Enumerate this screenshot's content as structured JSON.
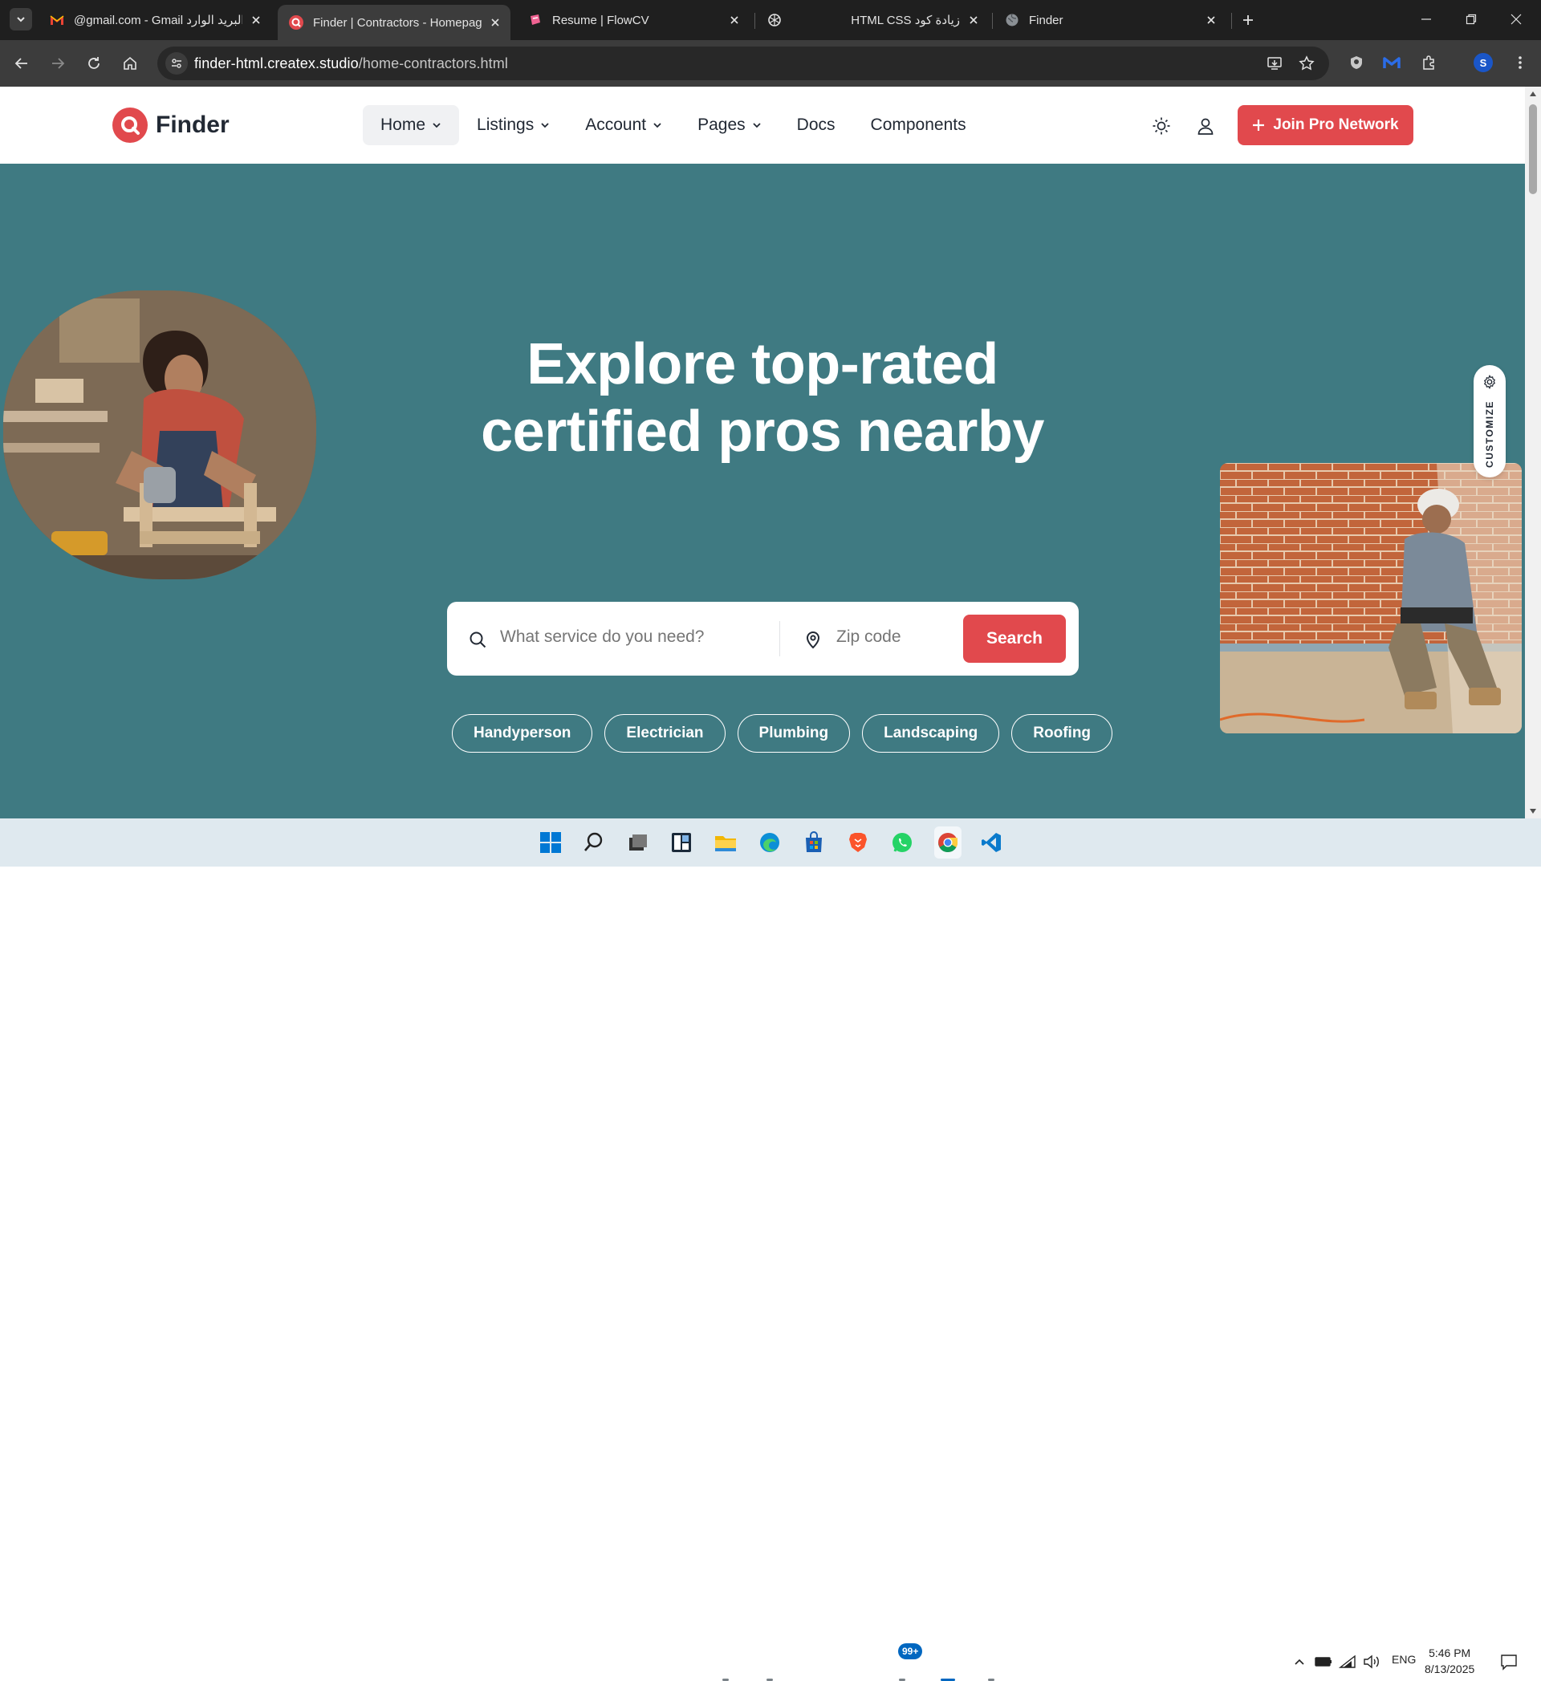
{
  "browser": {
    "tabs": [
      {
        "title": "@gmail.com - Gmail البريد الوارد",
        "favicon": "gmail-icon",
        "active": false
      },
      {
        "title": "Finder | Contractors - Homepage",
        "favicon": "finder-icon",
        "active": true
      },
      {
        "title": "Resume | FlowCV",
        "favicon": "flowcv-icon",
        "active": false
      },
      {
        "title": "HTML CSS زيادة كود",
        "favicon": "chatgpt-icon",
        "active": false
      },
      {
        "title": "Finder",
        "favicon": "globe-icon",
        "active": false
      }
    ],
    "url_host": "finder-html.createx.studio",
    "url_path": "/home-contractors.html",
    "profile_initial": "S"
  },
  "site": {
    "logo_text": "Finder",
    "nav": [
      {
        "label": "Home",
        "has_dropdown": true,
        "active": true
      },
      {
        "label": "Listings",
        "has_dropdown": true,
        "active": false
      },
      {
        "label": "Account",
        "has_dropdown": true,
        "active": false
      },
      {
        "label": "Pages",
        "has_dropdown": true,
        "active": false
      },
      {
        "label": "Docs",
        "has_dropdown": false,
        "active": false
      },
      {
        "label": "Components",
        "has_dropdown": false,
        "active": false
      }
    ],
    "join_button": "Join Pro Network",
    "hero": {
      "title_line1": "Explore top-rated",
      "title_line2": "certified pros nearby",
      "search_placeholder": "What service do you need?",
      "zip_placeholder": "Zip code",
      "search_button": "Search",
      "chips": [
        "Handyperson",
        "Electrician",
        "Plumbing",
        "Landscaping",
        "Roofing"
      ]
    },
    "customize_label": "CUSTOMIZE"
  },
  "colors": {
    "brand": "#e1494d",
    "hero_bg": "#3f7a82",
    "text_dark": "#222934"
  },
  "taskbar": {
    "whatsapp_badge": "99+",
    "language": "ENG",
    "time": "5:46 PM",
    "date": "8/13/2025"
  }
}
